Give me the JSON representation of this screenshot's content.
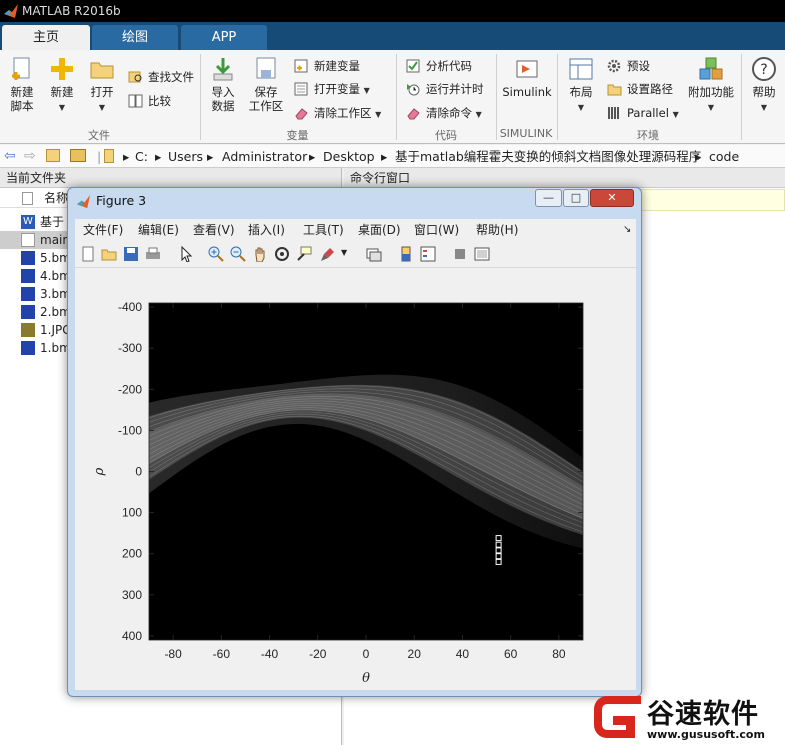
{
  "window": {
    "title": "MATLAB R2016b"
  },
  "tabs": [
    {
      "label": "主页"
    },
    {
      "label": "绘图"
    },
    {
      "label": "APP"
    }
  ],
  "ribbon": {
    "new_script": "新建\n脚本",
    "new": "新建",
    "open": "打开",
    "find_files": "查找文件",
    "compare": "比较",
    "import_data": "导入\n数据",
    "save_workspace": "保存\n工作区",
    "new_variable": "新建变量",
    "open_variable": "打开变量",
    "clear_workspace": "清除工作区",
    "analyze_code": "分析代码",
    "run_and_time": "运行并计时",
    "clear_commands": "清除命令",
    "simulink": "Simulink",
    "layout": "布局",
    "preferences": "预设",
    "set_path": "设置路径",
    "parallel": "Parallel",
    "addons": "附加功能",
    "help": "帮助",
    "groups": {
      "file": "文件",
      "variable": "变量",
      "code": "代码",
      "simulink": "SIMULINK",
      "environment": "环境"
    }
  },
  "address": {
    "path": [
      "C:",
      "Users",
      "Administrator",
      "Desktop",
      "基于matlab编程霍夫变换的倾斜文档图像处理源码程序",
      "code"
    ]
  },
  "left_panel": {
    "title": "当前文件夹",
    "column": "名称",
    "files": [
      {
        "name": "基于",
        "type": "doc"
      },
      {
        "name": "main",
        "type": "m"
      },
      {
        "name": "5.bm",
        "type": "bmp"
      },
      {
        "name": "4.bm",
        "type": "bmp"
      },
      {
        "name": "3.bm",
        "type": "bmp"
      },
      {
        "name": "2.bm",
        "type": "bmp"
      },
      {
        "name": "1.JPG",
        "type": "jpg"
      },
      {
        "name": "1.bm",
        "type": "bmp"
      }
    ]
  },
  "right_panel": {
    "title": "命令行窗口"
  },
  "figure": {
    "title": "Figure 3",
    "menu": [
      "文件(F)",
      "编辑(E)",
      "查看(V)",
      "插入(I)",
      "工具(T)",
      "桌面(D)",
      "窗口(W)",
      "帮助(H)"
    ],
    "window_buttons": {
      "minimize": "—",
      "maximize": "□",
      "close": "✕"
    }
  },
  "chart_data": {
    "type": "heatmap",
    "title": "",
    "xlabel": "θ",
    "ylabel": "ρ",
    "xlim": [
      -90,
      90
    ],
    "ylim": [
      -410,
      410
    ],
    "y_reversed": true,
    "x_ticks": [
      -80,
      -60,
      -40,
      -20,
      0,
      20,
      40,
      60,
      80
    ],
    "y_ticks": [
      -400,
      -300,
      -200,
      -100,
      0,
      100,
      200,
      300,
      400
    ],
    "colormap": "gray",
    "peaks": [
      {
        "theta": 55,
        "rho": 162
      },
      {
        "theta": 55,
        "rho": 178
      },
      {
        "theta": 55,
        "rho": 192
      },
      {
        "theta": 55,
        "rho": 206
      },
      {
        "theta": 55,
        "rho": 220
      }
    ]
  },
  "colors": {
    "tabbar": "#164b78",
    "figure_frame": "#c7daf0",
    "plot_bg": "#000000"
  },
  "watermark": {
    "brand": "谷速软件",
    "url": "www.gususoft.com"
  }
}
